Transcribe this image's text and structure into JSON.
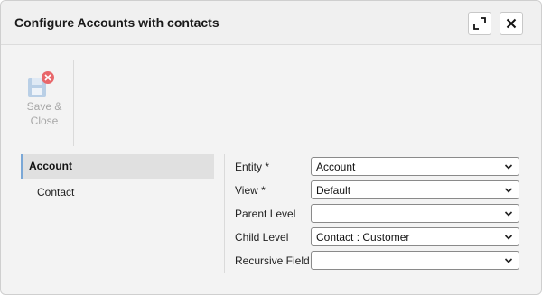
{
  "dialog": {
    "title": "Configure Accounts with contacts",
    "expand_icon": "expand-icon",
    "close_icon": "close-icon"
  },
  "toolbar": {
    "save_close_line1": "Save &",
    "save_close_line2": "Close",
    "save_icon": "save-disabled-icon"
  },
  "nav": {
    "items": [
      {
        "label": "Account",
        "selected": true
      },
      {
        "label": "Contact",
        "selected": false
      }
    ]
  },
  "form": {
    "fields": [
      {
        "label": "Entity *",
        "value": "Account"
      },
      {
        "label": "View *",
        "value": "Default"
      },
      {
        "label": "Parent Level",
        "value": ""
      },
      {
        "label": "Child Level",
        "value": "Contact : Customer"
      },
      {
        "label": "Recursive Field",
        "value": ""
      }
    ]
  },
  "colors": {
    "accent_border": "#7aa7d6",
    "disabled_text": "#a8a8a8",
    "error_badge": "#e8676b"
  }
}
